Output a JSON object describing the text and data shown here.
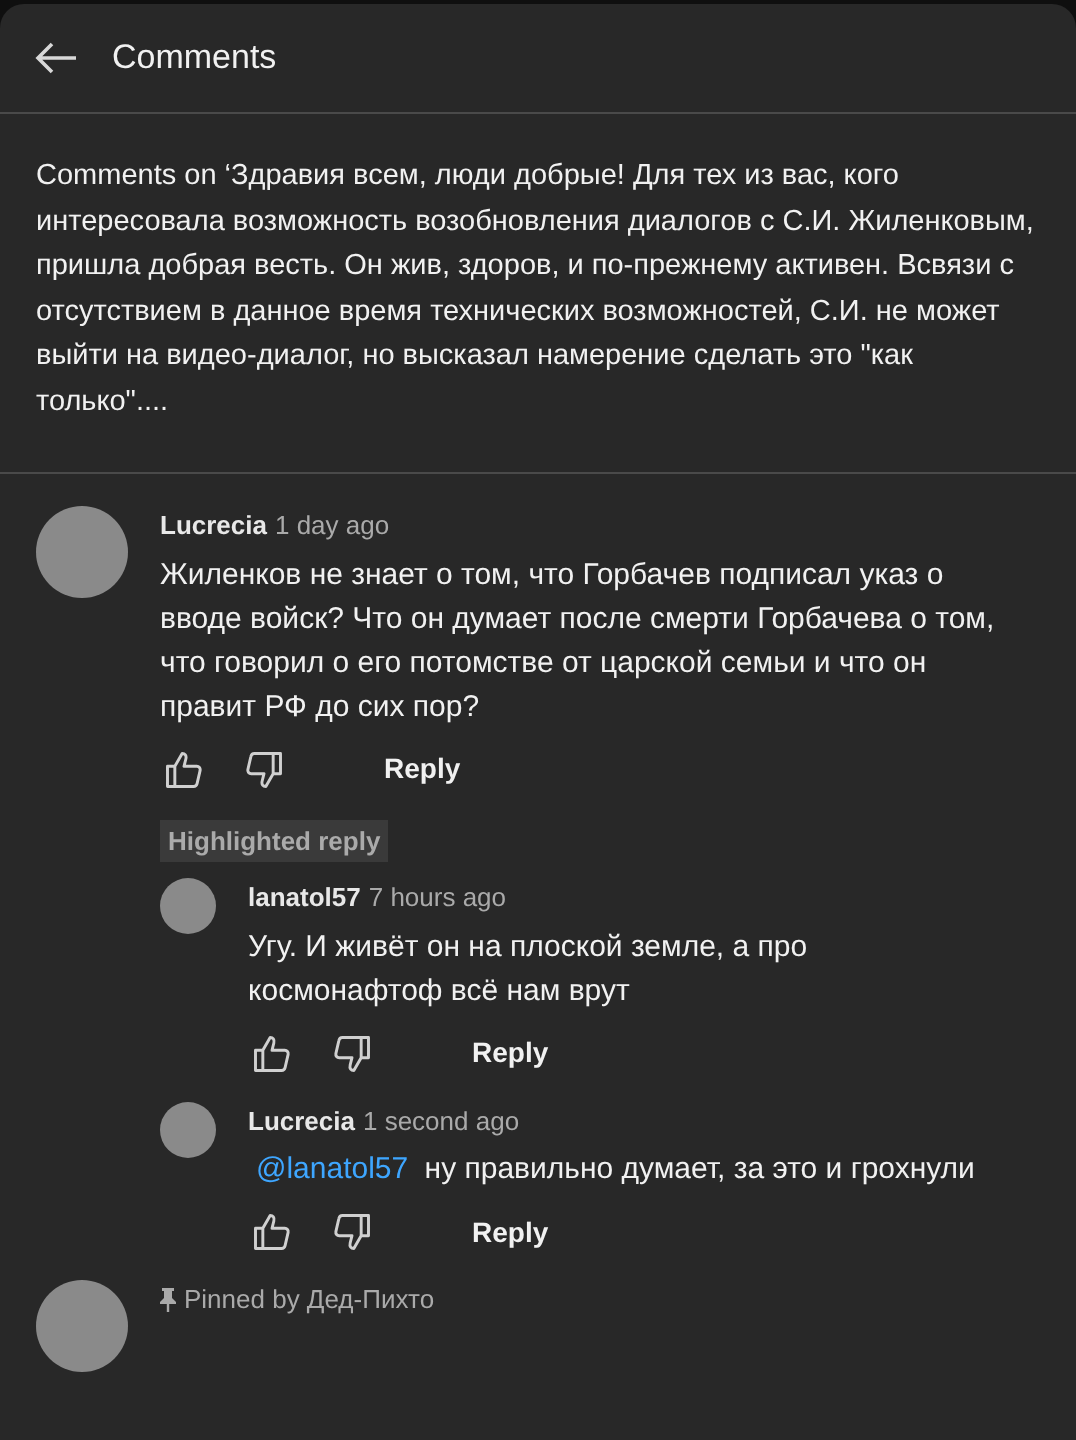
{
  "header": {
    "title": "Comments"
  },
  "description": "Comments on ‘Здравия всем, люди добрые! Для тех из вас, кого интересовала возможность возобновления диалогов с С.И. Жиленковым, пришла добрая весть. Он жив, здоров, и по-прежнему активен. Всвязи с отсутствием в данное время технических возможностей, С.И. не может выйти на видео-диалог, но высказал намерение сделать это \"как только\"....",
  "comments": [
    {
      "author": "Lucrecia",
      "time": "1 day ago",
      "text": "Жиленков не знает о том, что Горбачев подписал указ о вводе войск? Что он думает после смерти Горбачева о том, что говорил о его потомстве от царской семьи и что он правит РФ до сих пор?",
      "reply_label": "Reply",
      "replies": [
        {
          "badge": "Highlighted reply",
          "author": "lanatol57",
          "time": "7 hours ago",
          "text": "Угу. И живёт он на плоской земле, а про космонафтоф всё нам врут",
          "reply_label": "Reply"
        },
        {
          "author": "Lucrecia",
          "time": "1 second ago",
          "mention": "@lanatol57",
          "text": "ну правильно думает, за это и грохнули",
          "reply_label": "Reply"
        }
      ]
    },
    {
      "pinned": "Pinned by Дед-Пихто"
    }
  ]
}
